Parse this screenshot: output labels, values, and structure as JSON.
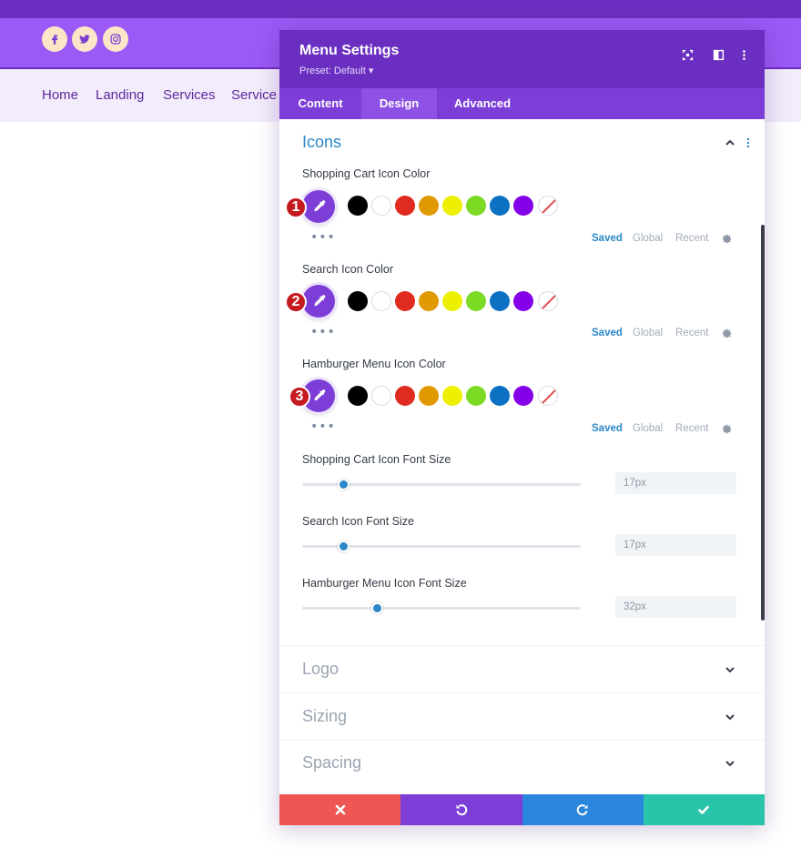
{
  "site": {
    "social": [
      "facebook-icon",
      "twitter-icon",
      "instagram-icon"
    ],
    "nav": [
      "Home",
      "Landing",
      "Services",
      "Service"
    ]
  },
  "modal": {
    "title": "Menu Settings",
    "preset": "Preset: Default ▾",
    "tabs": [
      {
        "label": "Content",
        "active": false
      },
      {
        "label": "Design",
        "active": true
      },
      {
        "label": "Advanced",
        "active": false
      }
    ],
    "icons_section": {
      "title": "Icons",
      "color_fields": [
        {
          "label": "Shopping Cart Icon Color",
          "step": "1"
        },
        {
          "label": "Search Icon Color",
          "step": "2"
        },
        {
          "label": "Hamburger Menu Icon Color",
          "step": "3"
        }
      ],
      "palette_tabs": [
        "Saved",
        "Global",
        "Recent"
      ],
      "swatches": [
        "#000000",
        "#ffffff",
        "#e02b20",
        "#e09900",
        "#edf000",
        "#7cda24",
        "#0c71c3",
        "#8300e9",
        "none"
      ],
      "size_fields": [
        {
          "label": "Shopping Cart Icon Font Size",
          "value": "17px",
          "level": 0.15
        },
        {
          "label": "Search Icon Font Size",
          "value": "17px",
          "level": 0.15
        },
        {
          "label": "Hamburger Menu Icon Font Size",
          "value": "32px",
          "level": 0.27
        }
      ]
    },
    "collapsed_sections": [
      "Logo",
      "Sizing",
      "Spacing"
    ],
    "footer_colors": [
      "#ef5555",
      "#7d3ed8",
      "#2b87dd",
      "#29c4a9"
    ]
  }
}
